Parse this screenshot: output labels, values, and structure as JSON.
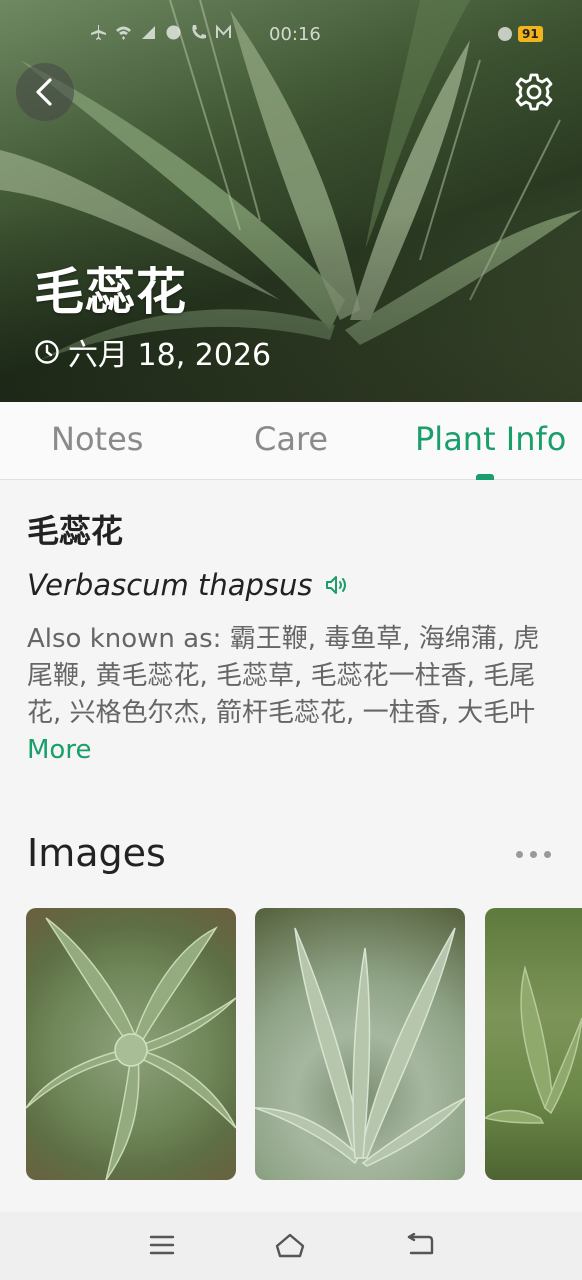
{
  "status_bar": {
    "time": "00:16",
    "battery": "91"
  },
  "header": {
    "title": "毛蕊花",
    "date": "六月 18, 2026",
    "back_icon": "chevron-left-icon",
    "settings_icon": "gear-icon"
  },
  "tabs": [
    {
      "label": "Notes",
      "active": false
    },
    {
      "label": "Care",
      "active": false
    },
    {
      "label": "Plant Info",
      "active": true
    }
  ],
  "plant_info": {
    "common_name": "毛蕊花",
    "scientific_name": "Verbascum thapsus",
    "also_known_prefix": "Also known as: ",
    "also_known_names": "霸王鞭, 毒鱼草, 海绵蒲, 虎尾鞭, 黄毛蕊花, 毛蕊草, 毛蕊花一柱香, 毛尾花, 兴格色尔杰, 箭杆毛蕊花, 一柱香, 大毛叶 ",
    "more_label": "More"
  },
  "images_section": {
    "title": "Images",
    "thumbnail_count_visible": 3
  },
  "colors": {
    "accent": "#1a9e6a",
    "tab_inactive": "#8a8a8a",
    "background": "#f5f5f5"
  }
}
